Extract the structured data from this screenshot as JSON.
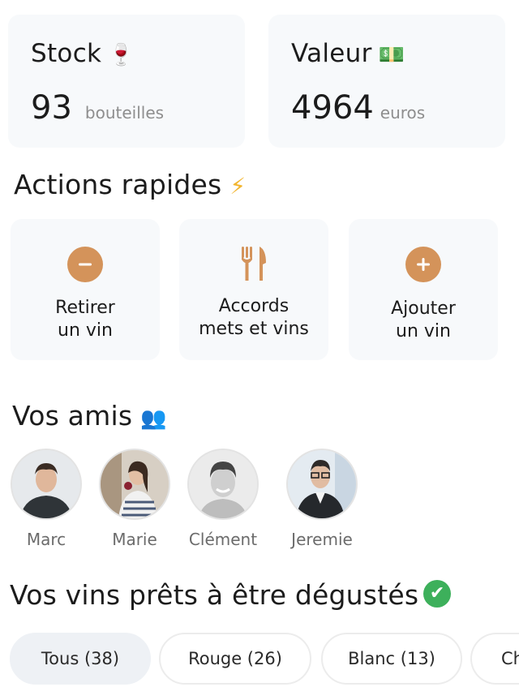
{
  "stats": {
    "stock": {
      "title": "Stock",
      "emoji": "🍷",
      "value": "93",
      "unit": "bouteilles"
    },
    "valeur": {
      "title": "Valeur",
      "emoji": "💵",
      "value": "4964",
      "unit": "euros"
    }
  },
  "actions": {
    "title": "Actions rapides",
    "icon": "⚡",
    "items": [
      {
        "label": "Retirer\nun vin",
        "icon": "minus-icon"
      },
      {
        "label": "Accords\nmets et vins",
        "icon": "fork-knife-icon"
      },
      {
        "label": "Ajouter\nun vin",
        "icon": "plus-icon"
      }
    ]
  },
  "friends": {
    "title": "Vos amis",
    "icon": "👥",
    "items": [
      {
        "name": "Marc"
      },
      {
        "name": "Marie"
      },
      {
        "name": "Clément"
      },
      {
        "name": "Jeremie"
      }
    ]
  },
  "wines": {
    "title": "Vos vins prêts à être dégustés",
    "icon": "✔",
    "filters": [
      {
        "label": "Tous (38)",
        "active": true
      },
      {
        "label": "Rouge (26)",
        "active": false
      },
      {
        "label": "Blanc (13)",
        "active": false
      },
      {
        "label": "Ch",
        "active": false
      }
    ]
  },
  "colors": {
    "accent": "#d4935a",
    "card_bg": "#f7f9fb",
    "check_green": "#3db05b"
  }
}
